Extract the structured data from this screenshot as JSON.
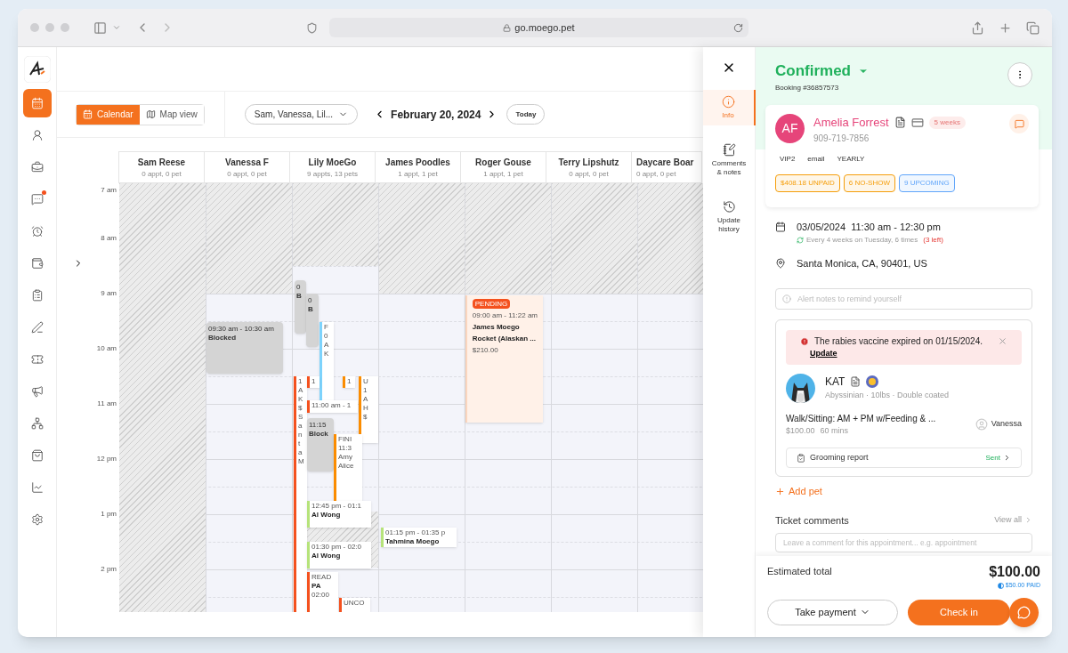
{
  "browser": {
    "url": "go.moego.pet"
  },
  "nav": [
    {
      "selected": true,
      "dot": false
    },
    {
      "selected": false,
      "dot": false
    },
    {
      "selected": false,
      "dot": false
    },
    {
      "selected": false,
      "dot": true
    },
    {
      "selected": false,
      "dot": false
    },
    {
      "selected": false,
      "dot": false
    },
    {
      "selected": false,
      "dot": false
    },
    {
      "selected": false,
      "dot": false
    },
    {
      "selected": false,
      "dot": false
    },
    {
      "selected": false,
      "dot": false
    },
    {
      "selected": false,
      "dot": false
    },
    {
      "selected": false,
      "dot": false
    },
    {
      "selected": false,
      "dot": false
    },
    {
      "selected": false,
      "dot": false
    }
  ],
  "toolbar": {
    "views": [
      {
        "label": "Calendar",
        "selected": true
      },
      {
        "label": "Map view",
        "selected": false
      }
    ],
    "staff_filter": "Sam, Vanessa, Lil...",
    "date": "February 20, 2024",
    "today": "Today"
  },
  "calendar": {
    "hours": [
      "7 am",
      "8 am",
      "9 am",
      "10 am",
      "11 am",
      "12 pm",
      "1 pm",
      "2 pm"
    ],
    "staff": [
      {
        "name": "Sam Reese",
        "count": "0 appt, 0 pet"
      },
      {
        "name": "Vanessa F",
        "count": "0 appt, 0 pet"
      },
      {
        "name": "Lily MoeGo",
        "count": "9 appts, 13 pets"
      },
      {
        "name": "James Poodles",
        "count": "1 appt, 1 pet"
      },
      {
        "name": "Roger Gouse",
        "count": "1 appt, 1 pet"
      },
      {
        "name": "Terry Lipshutz",
        "count": "0 appt, 0 pet"
      },
      {
        "name": "Daycare Boar",
        "count": "0 appt, 0 pet"
      }
    ],
    "events": [
      {
        "kind": "blocked",
        "color": "#d4d4d4",
        "lines": [
          "09:30 am - 10:30 am",
          "Blocked"
        ]
      },
      {
        "kind": "blocked",
        "color": "#d4d4d4",
        "lines": [
          "0",
          "B"
        ]
      },
      {
        "kind": "blocked",
        "color": "#d4d4d4",
        "lines": [
          "0",
          "B"
        ]
      },
      {
        "kind": "appointment",
        "color": "#7dd3fc",
        "lines": [
          "F",
          "0",
          "A",
          "K"
        ]
      },
      {
        "kind": "appointment",
        "color": "#f4511e",
        "lines": [
          "1",
          "A",
          "K",
          "$",
          "S",
          "a",
          "n",
          "t",
          "a",
          "M"
        ]
      },
      {
        "kind": "appointment",
        "color": "#f4511e",
        "lines": [
          "1"
        ]
      },
      {
        "kind": "appointment",
        "color": "#fb8c00",
        "lines": [
          "1"
        ]
      },
      {
        "kind": "appointment",
        "color": "#fb8c00",
        "lines": [
          "U",
          "1",
          "A",
          "H",
          "$"
        ]
      },
      {
        "kind": "appointment",
        "color": "#f4511e",
        "lines": [
          "11:00 am - 1"
        ]
      },
      {
        "kind": "blocked",
        "color": "#d4d4d4",
        "lines": [
          "11:15",
          "Block"
        ]
      },
      {
        "kind": "appointment",
        "color": "#fb8c00",
        "lines": [
          "FINI",
          "11:3",
          "Amy",
          "Alice"
        ]
      },
      {
        "kind": "appointment",
        "color": "#b6e37a",
        "lines": [
          "12:45 pm - 01:1",
          "Al Wong"
        ]
      },
      {
        "kind": "appointment",
        "color": "#b6e37a",
        "lines": [
          "01:30 pm - 02:0",
          "Al Wong"
        ]
      },
      {
        "kind": "appointment",
        "color": "#b6e37a",
        "lines": [
          "01:15 pm - 01:35 p",
          "Tahmina Moego"
        ]
      },
      {
        "kind": "appointment",
        "color": "#f4511e",
        "lines": [
          "READ",
          "PA",
          "02:00"
        ]
      },
      {
        "kind": "appointment",
        "color": "#f4511e",
        "lines": [
          "UNCO"
        ]
      },
      {
        "kind": "pending",
        "color": "#fbd5bd",
        "badge": "PENDING",
        "lines": [
          "09:00 am - 11:22 am",
          "James Moego",
          "Rocket  (Alaskan ...",
          "$210.00"
        ]
      }
    ]
  },
  "drawer": {
    "tabs": [
      {
        "label": "Info",
        "selected": true
      },
      {
        "label": "Comments & notes",
        "selected": false
      },
      {
        "label": "Update history",
        "selected": false
      }
    ]
  },
  "detail": {
    "status": "Confirmed",
    "booking": "Booking #36857573",
    "client": {
      "initials": "AF",
      "name": "Amelia Forrest",
      "phone": "909-719-7856",
      "membership": "5 weeks",
      "tags": [
        "VIP2",
        "email",
        "YEARLY"
      ],
      "badges": [
        {
          "label": "$408.18 UNPAID",
          "color": "#f59e0b"
        },
        {
          "label": "6 NO-SHOW",
          "color": "#f59e0b"
        },
        {
          "label": "9 UPCOMING",
          "color": "#60a5fa"
        }
      ]
    },
    "appointment": {
      "date": "03/05/2024  11:30 am - 12:30 pm",
      "recurrence": "Every 4 weeks on Tuesday, 6 times",
      "remaining": "(3 left)",
      "location": "Santa Monica, CA, 90401, US"
    },
    "alert_placeholder": "Alert notes to remind yourself",
    "pet": {
      "warning": "The rabies vaccine expired on 01/15/2024.",
      "warning_link": "Update",
      "name": "KAT",
      "details": "Abyssinian · 10lbs · Double coated",
      "service": "Walk/Sitting: AM + PM w/Feeding & ...",
      "price": "$100.00",
      "duration": "60 mins",
      "staff": "Vanessa",
      "report": "Grooming report",
      "report_status": "Sent"
    },
    "add_pet": "Add pet",
    "comments": {
      "title": "Ticket comments",
      "view_all": "View all",
      "placeholder": "Leave a comment for this appointment... e.g. appointment"
    },
    "footer": {
      "label": "Estimated total",
      "total": "$100.00",
      "paid": "$50.00 PAID",
      "take_payment": "Take payment",
      "check_in": "Check in"
    }
  }
}
